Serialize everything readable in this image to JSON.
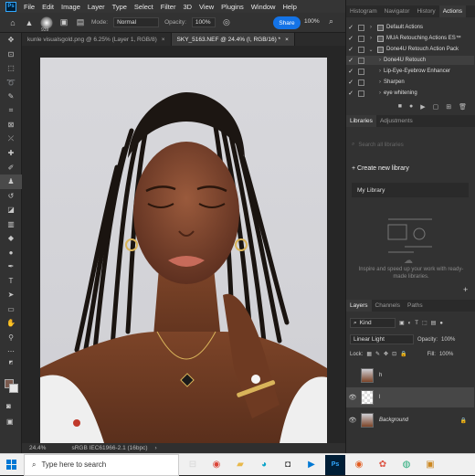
{
  "menubar": {
    "logo": "Ps",
    "items": [
      "File",
      "Edit",
      "Image",
      "Layer",
      "Type",
      "Select",
      "Filter",
      "3D",
      "View",
      "Plugins",
      "Window",
      "Help"
    ],
    "window_controls": [
      "—",
      "□",
      "✕"
    ]
  },
  "options": {
    "brush_size": "939",
    "mode_label": "Mode:",
    "mode_value": "Normal",
    "opacity_label": "Opacity:",
    "opacity_value": "100%",
    "share_label": "Share",
    "flow_value": "100%"
  },
  "doc_tabs": [
    {
      "label": "kunle visualsgold.png @ 6.25% (Layer 1, RGB/8)",
      "close": "×"
    },
    {
      "label": "SKY_5163.NEF @ 24.4% (I, RGB/16) *",
      "close": "×"
    }
  ],
  "status": {
    "zoom": "24.4%",
    "profile": "sRGB IEC61966-2.1 (16bpc)"
  },
  "panel_tabs_top": [
    "Histogram",
    "Navigator",
    "History",
    "Actions"
  ],
  "actions": [
    {
      "label": "Default Actions",
      "checked": true,
      "expanded": false,
      "selected": false
    },
    {
      "label": "MUA Retouching Actions ES™",
      "checked": true,
      "expanded": false,
      "selected": false
    },
    {
      "label": "Done4U Retouch Action Pack",
      "checked": true,
      "expanded": true,
      "selected": false
    },
    {
      "label": "Done4U Retouch",
      "checked": true,
      "expanded": false,
      "selected": true
    },
    {
      "label": "Lip-Eye-Eyebrow Enhancer",
      "checked": true,
      "expanded": false,
      "selected": false
    },
    {
      "label": "Sharpen",
      "checked": true,
      "expanded": false,
      "selected": false
    },
    {
      "label": "eye whitening",
      "checked": true,
      "expanded": false,
      "selected": false
    }
  ],
  "libraries": {
    "tabs": [
      "Libraries",
      "Adjustments"
    ],
    "search_placeholder": "Search all libraries",
    "create_label": "Create new library",
    "my_library": "My Library",
    "message": "Inspire and speed up your work with ready-made libraries."
  },
  "layers": {
    "tabs": [
      "Layers",
      "Channels",
      "Paths"
    ],
    "kind_label": "Kind",
    "blend_mode": "Linear Light",
    "opacity_label": "Opacity:",
    "opacity_value": "100%",
    "lock_label": "Lock:",
    "fill_label": "Fill:",
    "fill_value": "100%",
    "rows": [
      {
        "name": "h",
        "visible": false,
        "selected": false,
        "italic": false
      },
      {
        "name": "l",
        "visible": true,
        "selected": true,
        "italic": false
      },
      {
        "name": "Background",
        "visible": true,
        "selected": false,
        "italic": true
      }
    ]
  },
  "taskbar": {
    "search_placeholder": "Type here to search"
  },
  "colors": {
    "accent": "#1473e6",
    "panel_bg": "#323232",
    "dark_bg": "#262626"
  }
}
